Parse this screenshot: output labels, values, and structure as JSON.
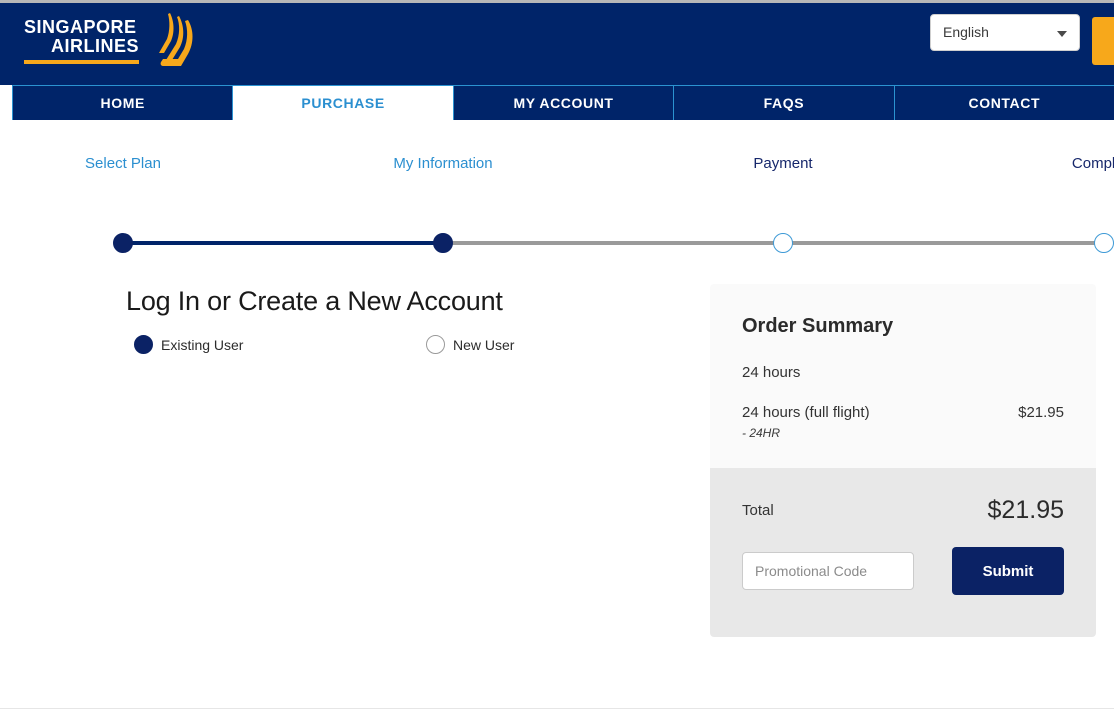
{
  "header": {
    "logo": {
      "line1": "SINGAPORE",
      "line2": "AIRLINES",
      "bird_icon": "singapore-airlines-bird-logo"
    },
    "language": {
      "value": "English",
      "caret_icon": "chevron-down-icon"
    },
    "accent_button_color": "#f7a81b",
    "brand_navy": "#002469"
  },
  "nav": {
    "items": [
      {
        "label": "HOME",
        "active": false
      },
      {
        "label": "PURCHASE",
        "active": true
      },
      {
        "label": "MY ACCOUNT",
        "active": false
      },
      {
        "label": "FAQS",
        "active": false
      },
      {
        "label": "CONTACT",
        "active": false
      }
    ],
    "divider_color": "#2b93d1",
    "active_text_color": "#2b8fd0"
  },
  "stepper": {
    "steps": [
      {
        "label": "Select Plan",
        "state": "done"
      },
      {
        "label": "My Information",
        "state": "done"
      },
      {
        "label": "Payment",
        "state": "todo"
      },
      {
        "label": "Complete",
        "state": "todo"
      }
    ],
    "done_color": "#0b2265",
    "todo_color": "#9a9a9a"
  },
  "main": {
    "title": "Log In or Create a New Account",
    "account_options": [
      {
        "label": "Existing User",
        "selected": true
      },
      {
        "label": "New User",
        "selected": false
      }
    ]
  },
  "order_summary": {
    "title": "Order Summary",
    "plan_name": "24 hours",
    "line_items": [
      {
        "label": "24 hours (full flight)",
        "amount": "$21.95",
        "sub": "- 24HR"
      }
    ],
    "total_label": "Total",
    "total_amount": "$21.95",
    "promo_placeholder": "Promotional Code",
    "promo_value": "",
    "submit_label": "Submit"
  }
}
